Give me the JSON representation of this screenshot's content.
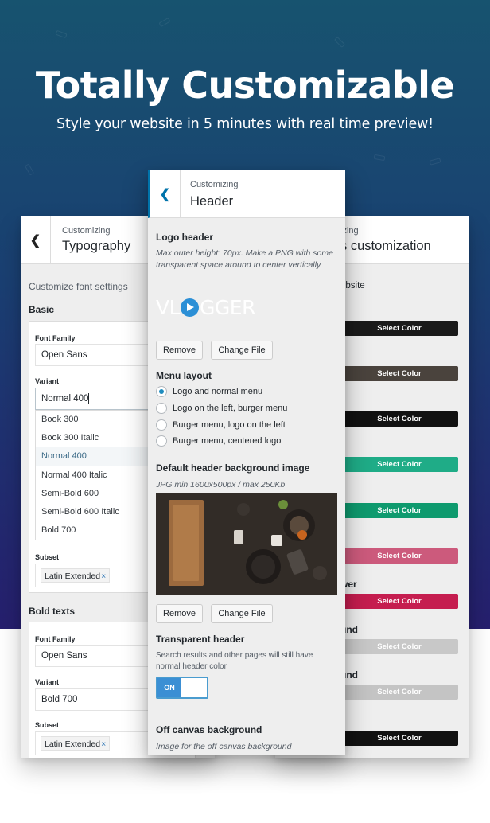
{
  "hero": {
    "title": "Totally Customizable",
    "subtitle": "Style your website in 5 minutes with real time preview!"
  },
  "left_panel": {
    "kicker": "Customizing",
    "title": "Typography",
    "intro": "Customize font settings",
    "basic": {
      "heading": "Basic",
      "font_family_label": "Font Family",
      "font_family_value": "Open Sans",
      "variant_label": "Variant",
      "variant_value": "Normal 400",
      "variant_options": [
        "Book 300",
        "Book 300 Italic",
        "Normal 400",
        "Normal 400 Italic",
        "Semi-Bold 600",
        "Semi-Bold 600 Italic",
        "Bold 700"
      ],
      "subset_label": "Subset",
      "subset_tag": "Latin Extended",
      "remove_tag": "×"
    },
    "bold": {
      "heading": "Bold texts",
      "font_family_label": "Font Family",
      "font_family_value": "Open Sans",
      "variant_label": "Variant",
      "variant_value": "Bold 700",
      "subset_label": "Subset",
      "subset_tag": "Latin Extended",
      "remove_tag": "×"
    }
  },
  "center_panel": {
    "kicker": "Customizing",
    "title": "Header",
    "logo_header": {
      "heading": "Logo header",
      "note": "Max outer height: 70px. Make a PNG with some transparent space around to center vertically.",
      "logo_left": "VL",
      "logo_right": "GGER",
      "remove": "Remove",
      "change": "Change File"
    },
    "menu_layout": {
      "heading": "Menu layout",
      "options": [
        "Logo and normal menu",
        "Logo on the left, burger menu",
        "Burger menu, logo on the left",
        "Burger menu, centered logo"
      ],
      "selected_index": 0
    },
    "bg_image": {
      "heading": "Default header background image",
      "note": "JPG min 1600x500px / max 250Kb",
      "remove": "Remove",
      "change": "Change File"
    },
    "transparent": {
      "heading": "Transparent header",
      "note": "Search results and other pages will still have normal header color",
      "toggle": "ON"
    },
    "offcanvas": {
      "heading": "Off canvas background",
      "note": "Image for the off canvas background"
    }
  },
  "right_panel": {
    "kicker_frag": "izing",
    "title_frag": "s customization",
    "intro_frag": "ebsite",
    "label_frags": [
      "wer",
      "und",
      "und"
    ],
    "color_buttons": [
      {
        "label": "Select Color",
        "color": "#1a1a1a"
      },
      {
        "label": "Select Color",
        "color": "#4a433d"
      },
      {
        "label": "Select Color",
        "color": "#111111"
      },
      {
        "label": "Select Color",
        "color": "#1fac87"
      },
      {
        "label": "Select Color",
        "color": "#0e9a6e"
      },
      {
        "label": "Select Color",
        "color": "#cc5a7c"
      },
      {
        "label": "Select Color",
        "color": "#c51d4f"
      },
      {
        "label": "Select Color",
        "color": "#c8c8c8"
      },
      {
        "label": "Select Color",
        "color": "#c4c4c4"
      },
      {
        "label": "Select Color",
        "color": "#111111"
      }
    ]
  }
}
